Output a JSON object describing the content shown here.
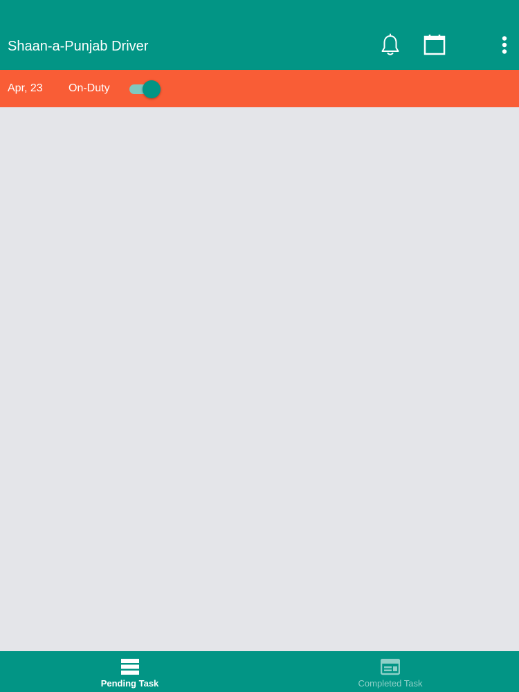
{
  "app_bar": {
    "title": "Shaan-a-Punjab Driver",
    "icons": [
      "bell-icon",
      "calendar-icon",
      "more-vertical-icon"
    ]
  },
  "status_bar": {
    "date": "Apr, 23",
    "duty_label": "On-Duty",
    "duty_on": true
  },
  "bottom_nav": {
    "items": [
      {
        "label": "Pending Task",
        "icon": "pending-task-icon",
        "active": true
      },
      {
        "label": "Completed Task",
        "icon": "completed-task-icon",
        "active": false
      }
    ]
  },
  "colors": {
    "primary": "#029585",
    "accent": "#f95d36",
    "background": "#e4e5e9",
    "inactive_nav": "#8fd0c8"
  }
}
